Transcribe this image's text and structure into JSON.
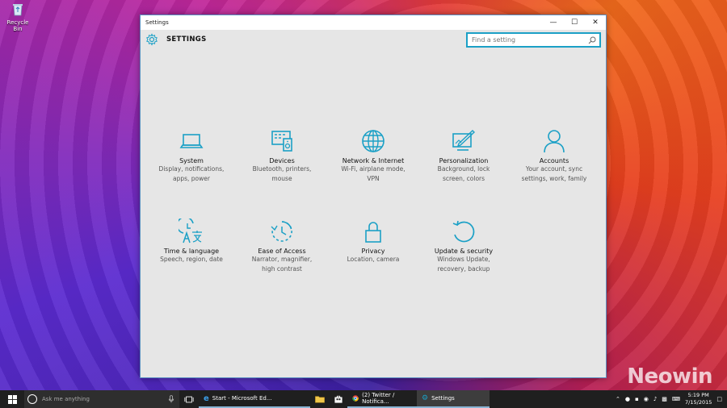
{
  "desktop": {
    "recycle_bin_label": "Recycle Bin",
    "watermark": "Neowin"
  },
  "window": {
    "title": "Settings",
    "header_title": "SETTINGS",
    "search_placeholder": "Find a setting",
    "accent_color": "#1ba0c6"
  },
  "tiles": [
    {
      "name": "System",
      "desc1": "Display, notifications,",
      "desc2": "apps, power",
      "icon": "laptop-icon"
    },
    {
      "name": "Devices",
      "desc1": "Bluetooth, printers,",
      "desc2": "mouse",
      "icon": "devices-icon"
    },
    {
      "name": "Network & Internet",
      "desc1": "Wi-Fi, airplane mode,",
      "desc2": "VPN",
      "icon": "globe-icon"
    },
    {
      "name": "Personalization",
      "desc1": "Background, lock",
      "desc2": "screen, colors",
      "icon": "paint-icon"
    },
    {
      "name": "Accounts",
      "desc1": "Your account, sync",
      "desc2": "settings, work, family",
      "icon": "person-icon"
    },
    {
      "name": "Time & language",
      "desc1": "Speech, region, date",
      "desc2": "",
      "icon": "time-language-icon"
    },
    {
      "name": "Ease of Access",
      "desc1": "Narrator, magnifier,",
      "desc2": "high contrast",
      "icon": "ease-access-icon"
    },
    {
      "name": "Privacy",
      "desc1": "Location, camera",
      "desc2": "",
      "icon": "lock-icon"
    },
    {
      "name": "Update & security",
      "desc1": "Windows Update,",
      "desc2": "recovery, backup",
      "icon": "refresh-icon"
    }
  ],
  "taskbar": {
    "search_text": "Ask me anything",
    "apps": [
      {
        "label": "Start - Microsoft Ed...",
        "icon": "edge-icon"
      },
      {
        "label": "(2) Twitter / Notifica...",
        "icon": "chrome-icon"
      },
      {
        "label": "Settings",
        "icon": "gear-icon"
      }
    ],
    "time": "5:19 PM",
    "date": "7/15/2015"
  }
}
